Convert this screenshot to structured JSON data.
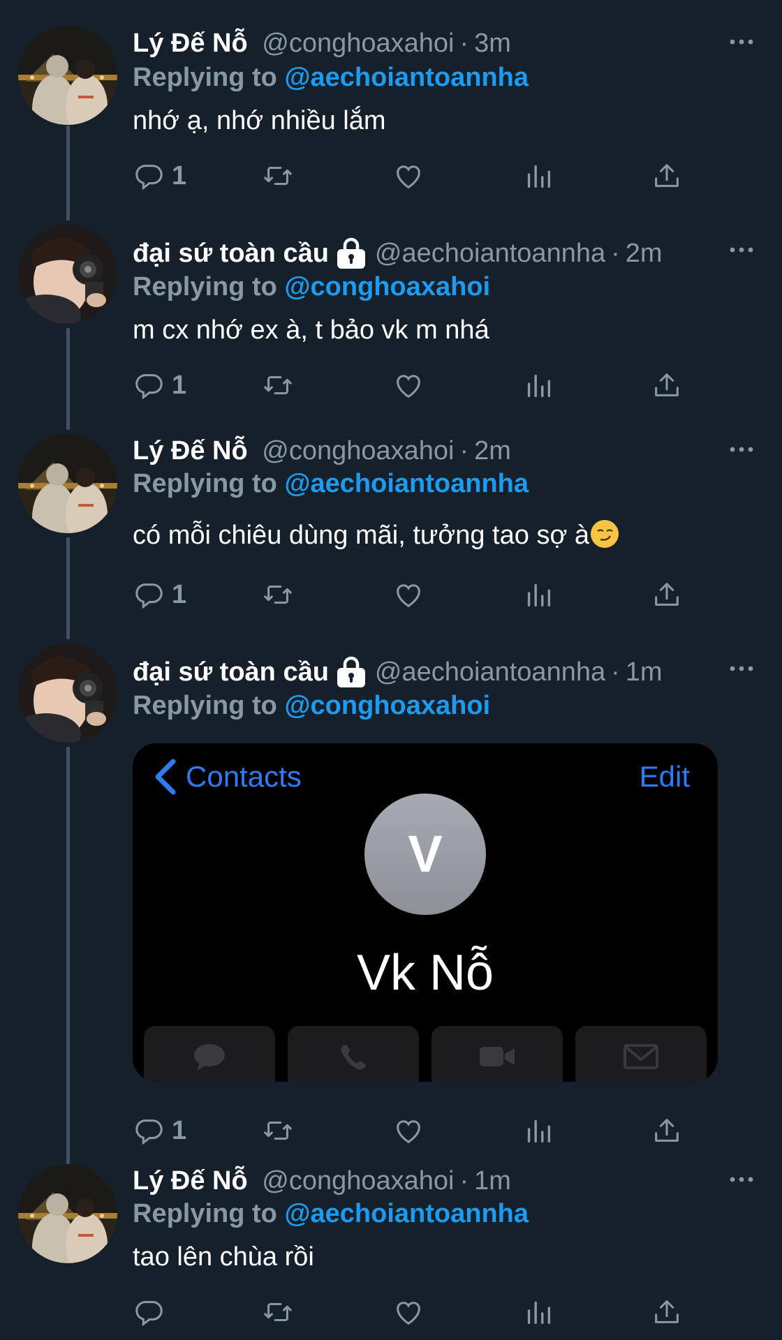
{
  "tweets": [
    {
      "name": "Lý Đế Nỗ",
      "handle": "@conghoaxahoi",
      "time": "3m",
      "locked": false,
      "replying_label": "Replying to",
      "replying_to": "@aechoiantoannha",
      "text": "nhớ ạ, nhớ nhiều lắm",
      "reply_count": "1"
    },
    {
      "name": "đại sứ toàn cầu",
      "handle": "@aechoiantoannha",
      "time": "2m",
      "locked": true,
      "replying_label": "Replying to",
      "replying_to": "@conghoaxahoi",
      "text": "m cx nhớ ex à, t bảo vk m nhá",
      "reply_count": "1"
    },
    {
      "name": "Lý Đế Nỗ",
      "handle": "@conghoaxahoi",
      "time": "2m",
      "locked": false,
      "replying_label": "Replying to",
      "replying_to": "@aechoiantoannha",
      "text": "có mỗi chiêu dùng mãi, tưởng tao sợ à",
      "reply_count": "1"
    },
    {
      "name": "đại sứ toàn cầu",
      "handle": "@aechoiantoannha",
      "time": "1m",
      "locked": true,
      "replying_label": "Replying to",
      "replying_to": "@conghoaxahoi",
      "reply_count": "1",
      "image_card": {
        "back_label": "Contacts",
        "edit_label": "Edit",
        "initial": "V",
        "contact_name": "Vk Nỗ",
        "buttons": [
          "message-icon",
          "phone-icon",
          "video-icon",
          "mail-icon"
        ]
      }
    },
    {
      "name": "Lý Đế Nỗ",
      "handle": "@conghoaxahoi",
      "time": "1m",
      "locked": false,
      "replying_label": "Replying to",
      "replying_to": "@aechoiantoannha",
      "text": "tao lên chùa rồi",
      "reply_count": ""
    }
  ],
  "colors": {
    "background": "#15202b",
    "secondary_text": "#8899a6",
    "link": "#1d9bf0",
    "ios_blue": "#2f7bf5"
  },
  "icons": [
    "reply-icon",
    "retweet-icon",
    "like-icon",
    "analytics-icon",
    "share-icon",
    "more-icon",
    "lock-icon"
  ]
}
